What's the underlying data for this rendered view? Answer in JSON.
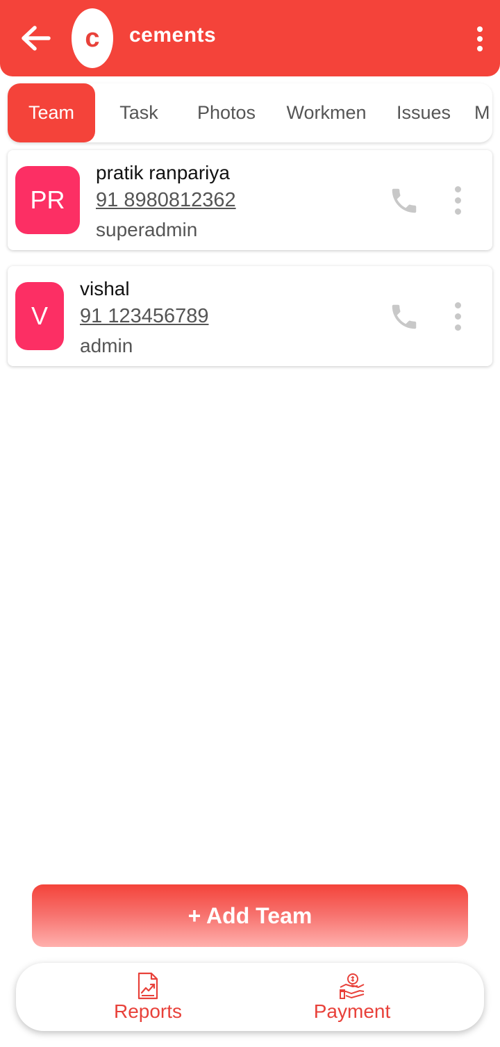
{
  "header": {
    "avatar_letter": "c",
    "title": "cements",
    "bg_color": "#f4433a"
  },
  "tabs": [
    {
      "label": "Team",
      "active": true
    },
    {
      "label": "Task",
      "active": false
    },
    {
      "label": "Photos",
      "active": false
    },
    {
      "label": "Workmen",
      "active": false
    },
    {
      "label": "Issues",
      "active": false
    },
    {
      "label": "M",
      "active": false
    }
  ],
  "members": [
    {
      "initials": "PR",
      "name": "pratik ranpariya",
      "phone": "91 8980812362",
      "role": "superadmin"
    },
    {
      "initials": "V",
      "name": "vishal",
      "phone": "91 123456789",
      "role": "admin"
    }
  ],
  "add_button_label": "+ Add Team",
  "bottom_nav": [
    {
      "label": "Reports",
      "icon": "report-icon"
    },
    {
      "label": "Payment",
      "icon": "payment-icon"
    }
  ],
  "colors": {
    "accent": "#f4433a",
    "badge": "#fc2f64",
    "icon_grey": "#c8c8c8"
  }
}
